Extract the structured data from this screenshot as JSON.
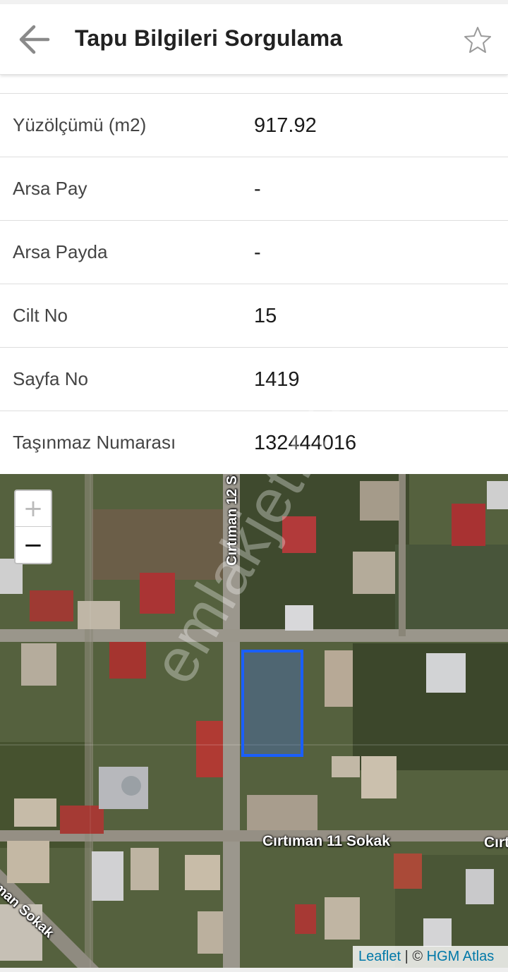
{
  "header": {
    "title": "Tapu Bilgileri Sorgulama",
    "back_icon": "arrow-left-icon",
    "favorite_icon": "star-outline-icon"
  },
  "details": [
    {
      "label": "Yüzölçümü (m2)",
      "value": "917.92"
    },
    {
      "label": "Arsa Pay",
      "value": "-"
    },
    {
      "label": "Arsa Payda",
      "value": "-"
    },
    {
      "label": "Cilt No",
      "value": "15"
    },
    {
      "label": "Sayfa No",
      "value": "1419"
    },
    {
      "label": "Taşınmaz Numarası",
      "value": "132444016"
    }
  ],
  "map": {
    "zoom_in": "+",
    "zoom_out": "−",
    "streets": {
      "vertical": "Cırtıman 12 S",
      "horizontal": "Cırtıman 11 Sokak",
      "diagonal": "man Sokak",
      "right_edge": "Cırt"
    },
    "parcel_color": "#1a5fff",
    "attribution_leaflet": "Leaflet",
    "attribution_sep": " | © ",
    "attribution_source": "HGM Atlas"
  },
  "watermark": "emlakjet.com"
}
